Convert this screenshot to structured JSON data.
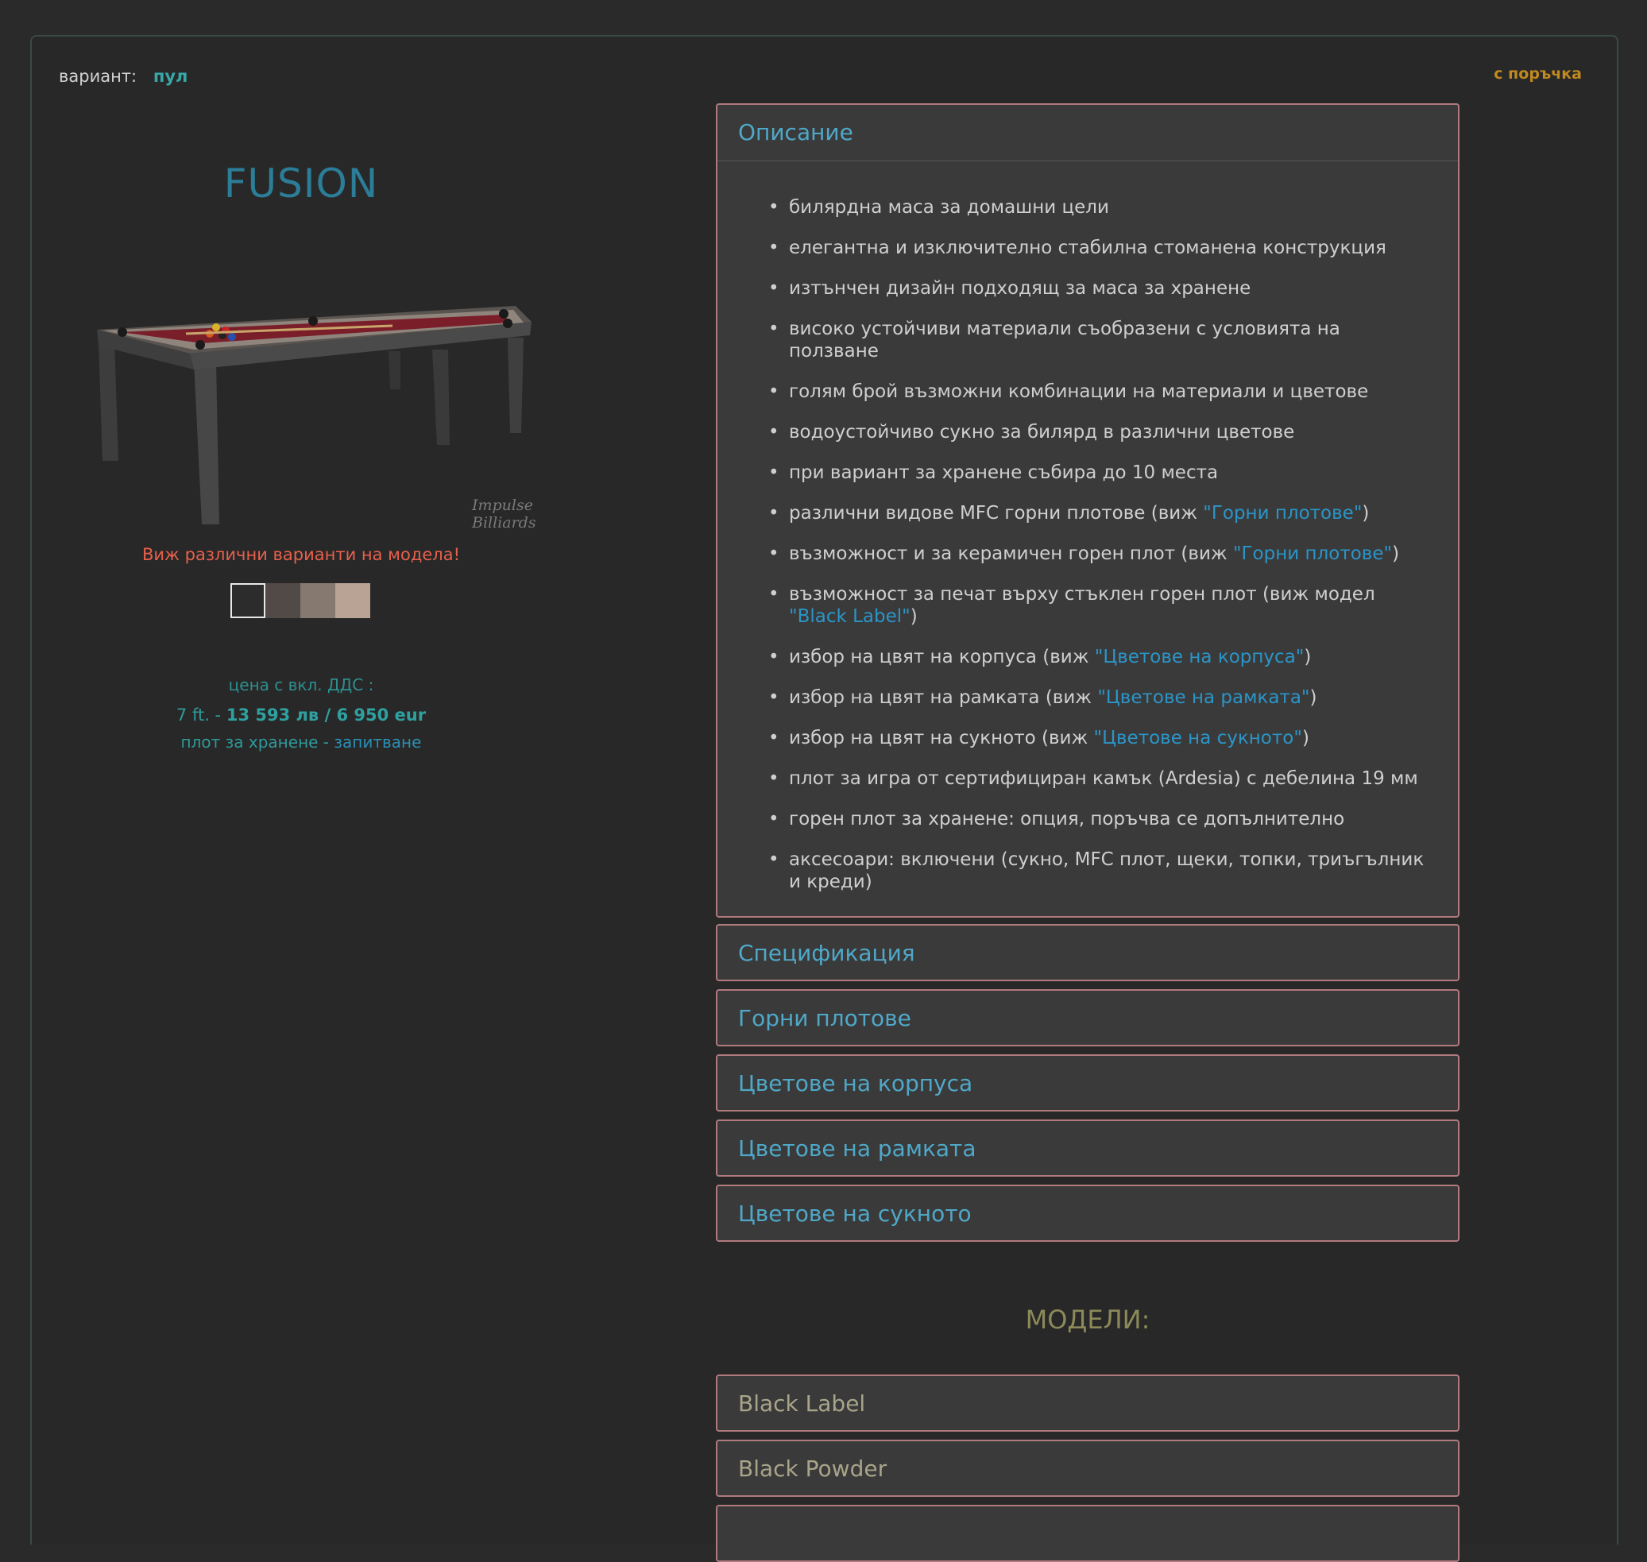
{
  "header": {
    "variant_label": "вариант:",
    "variant_value": "пул",
    "order_badge": "с поръчка"
  },
  "product": {
    "title": "FUSION",
    "watermark": "Impulse Billiards",
    "variants_link": "Виж различни варианти на модела!",
    "swatches": [
      "#2c2c2c",
      "#524a46",
      "#857970",
      "#b8a394"
    ],
    "price_label": "цена с вкл. ДДС :",
    "price_size": "7 ft. -",
    "price_value": "13 593 лв / 6 950 eur",
    "dining_label": "плот за хранене -",
    "dining_link": "запитване"
  },
  "description": {
    "title": "Описание",
    "items": [
      {
        "text": "билярдна маса за домашни цели"
      },
      {
        "text": "елегантна и изключително стабилна стоманена конструкция"
      },
      {
        "text": "изтънчен дизайн подходящ за маса за хранене"
      },
      {
        "text": "високо устойчиви материали съобразени с условията на ползване"
      },
      {
        "text": "голям брой възможни комбинации на материали и цветове"
      },
      {
        "text": "водоустойчиво сукно за билярд в различни цветове"
      },
      {
        "text": "при вариант за хранене събира до 10 места"
      },
      {
        "text": "различни видове MFC горни плотове (виж ",
        "link": "\"Горни плотове\"",
        "after": ")"
      },
      {
        "text": "възможност и за керамичен горен плот (виж ",
        "link": "\"Горни плотове\"",
        "after": ")"
      },
      {
        "text": "възможност за печат върху стъклен горен плот (виж модел ",
        "link": "\"Black Label\"",
        "after": ")"
      },
      {
        "text": "избор на цвят на корпуса (виж ",
        "link": "\"Цветове на корпуса\"",
        "after": ")"
      },
      {
        "text": "избор на цвят на рамката (виж ",
        "link": "\"Цветове на рамката\"",
        "after": ")"
      },
      {
        "text": "избор на цвят на сукното (виж ",
        "link": "\"Цветове на сукното\"",
        "after": ")"
      },
      {
        "text": "плот за игра от сертифициран камък (Ardesia) с дебелина 19 мм"
      },
      {
        "text": "горен плот за хранене: опция, поръчва се допълнително"
      },
      {
        "text": "аксесоари: включени (сукно, MFC плот, щеки, топки, триъгълник и креди)"
      }
    ]
  },
  "sections": [
    "Спецификация",
    "Горни плотове",
    "Цветове на корпуса",
    "Цветове на рамката",
    "Цветове на сукното"
  ],
  "models": {
    "title": "МОДЕЛИ:",
    "items": [
      "Black Label",
      "Black Powder"
    ]
  }
}
